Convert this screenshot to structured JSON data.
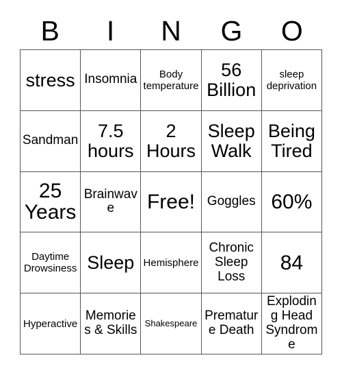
{
  "card": {
    "title": "BINGO",
    "header_letters": [
      "B",
      "I",
      "N",
      "G",
      "O"
    ],
    "border_color": "#555555",
    "text_color": "#000000",
    "background_color": "#ffffff",
    "grid_size": "5x5",
    "free_space": "Free!",
    "cells": [
      [
        {
          "label": "stress",
          "size": "xl"
        },
        {
          "label": "Insomnia",
          "size": "md"
        },
        {
          "label": "Body temperature",
          "size": "sm"
        },
        {
          "label": "56 Billion",
          "size": "xl"
        },
        {
          "label": "sleep deprivation",
          "size": "sm"
        }
      ],
      [
        {
          "label": "Sandman",
          "size": "md"
        },
        {
          "label": "7.5 hours",
          "size": "xl"
        },
        {
          "label": "2 Hours",
          "size": "xl"
        },
        {
          "label": "Sleep Walk",
          "size": "xl"
        },
        {
          "label": "Being Tired",
          "size": "xl"
        }
      ],
      [
        {
          "label": "25 Years",
          "size": "xxl"
        },
        {
          "label": "Brainwave",
          "size": "md"
        },
        {
          "label": "Free!",
          "size": "xxl"
        },
        {
          "label": "Goggles",
          "size": "md"
        },
        {
          "label": "60%",
          "size": "xxl"
        }
      ],
      [
        {
          "label": "Daytime Drowsiness",
          "size": "sm"
        },
        {
          "label": "Sleep",
          "size": "xl"
        },
        {
          "label": "Hemisphere",
          "size": "sm"
        },
        {
          "label": "Chronic Sleep Loss",
          "size": "md"
        },
        {
          "label": "84",
          "size": "xxl"
        }
      ],
      [
        {
          "label": "Hyperactive",
          "size": "sm"
        },
        {
          "label": "Memories & Skills",
          "size": "md"
        },
        {
          "label": "Shakespeare",
          "size": "xs"
        },
        {
          "label": "Premature Death",
          "size": "md"
        },
        {
          "label": "Exploding Head Syndrome",
          "size": "md"
        }
      ]
    ]
  }
}
